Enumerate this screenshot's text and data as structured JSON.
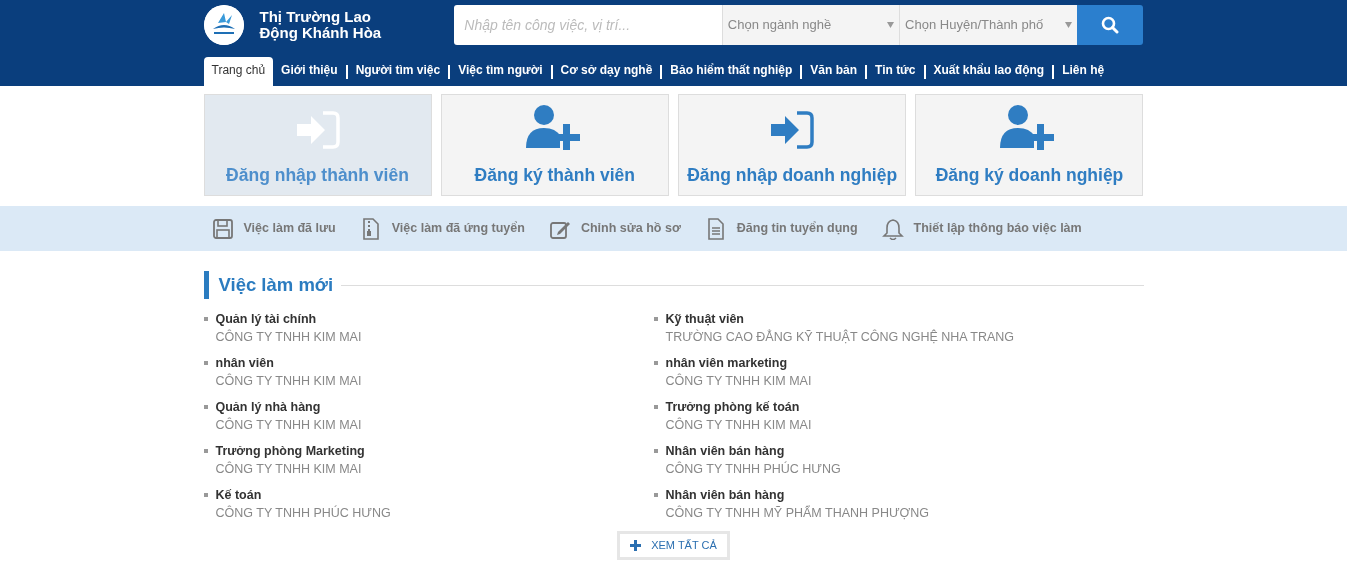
{
  "header": {
    "site_title_line1": "Thị Trường Lao",
    "site_title_line2": "Động Khánh Hòa",
    "search": {
      "placeholder": "Nhập tên công việc, vị trí..."
    },
    "selects": [
      {
        "value": "Chọn ngành nghề"
      },
      {
        "value": "Chọn Huyện/Thành phố"
      }
    ]
  },
  "nav": [
    {
      "label": "Trang chủ",
      "selected": true
    },
    {
      "label": "Giới thiệu",
      "selected": false
    },
    {
      "label": "Người tìm việc",
      "selected": false
    },
    {
      "label": "Việc tìm người",
      "selected": false
    },
    {
      "label": "Cơ sở dạy nghề",
      "selected": false
    },
    {
      "label": "Bảo hiểm thất nghiệp",
      "selected": false
    },
    {
      "label": "Văn bản",
      "selected": false
    },
    {
      "label": "Tin tức",
      "selected": false
    },
    {
      "label": "Xuất khẩu lao động",
      "selected": false
    },
    {
      "label": "Liên hệ",
      "selected": false
    }
  ],
  "action_cards": [
    {
      "kind": "login",
      "label": "Đăng nhập thành viên",
      "selected": true
    },
    {
      "kind": "register",
      "label": "Đăng ký thành viên",
      "selected": false
    },
    {
      "kind": "login",
      "label": "Đăng nhập doanh nghiệp",
      "selected": false
    },
    {
      "kind": "register",
      "label": "Đăng ký doanh nghiệp",
      "selected": false
    }
  ],
  "quick_links": [
    {
      "kind": "save",
      "label": "Việc làm đã lưu"
    },
    {
      "kind": "zip",
      "label": "Việc làm đã ứng tuyển"
    },
    {
      "kind": "edit",
      "label": "Chỉnh sửa hồ sơ"
    },
    {
      "kind": "document",
      "label": "Đăng tin tuyển dụng"
    },
    {
      "kind": "bell",
      "label": "Thiết lập thông báo việc làm"
    }
  ],
  "new_jobs": {
    "title": "Việc làm mới",
    "columns": [
      [
        {
          "title": "Quản lý tài chính",
          "company": "CÔNG TY TNHH KIM MAI"
        },
        {
          "title": "nhân viên",
          "company": "CÔNG TY TNHH KIM MAI"
        },
        {
          "title": "Quản lý nhà hàng",
          "company": "CÔNG TY TNHH KIM MAI"
        },
        {
          "title": "Trưởng phòng Marketing",
          "company": "CÔNG TY TNHH KIM MAI"
        },
        {
          "title": "Kế toán",
          "company": "CÔNG TY TNHH PHÚC HƯNG"
        }
      ],
      [
        {
          "title": "Kỹ thuật viên",
          "company": "TRƯỜNG CAO ĐẲNG KỸ THUẬT CÔNG NGHỆ NHA TRANG"
        },
        {
          "title": "nhân viên marketing",
          "company": "CÔNG TY TNHH KIM MAI"
        },
        {
          "title": "Trưởng phòng kế toán",
          "company": "CÔNG TY TNHH KIM MAI"
        },
        {
          "title": "Nhân viên bán hàng",
          "company": "CÔNG TY TNHH PHÚC HƯNG"
        },
        {
          "title": "Nhân viên bán hàng",
          "company": "CÔNG TY TNHH MỸ PHẨM THANH PHƯỢNG"
        }
      ]
    ],
    "view_all": "XEM TẤT CẢ"
  }
}
